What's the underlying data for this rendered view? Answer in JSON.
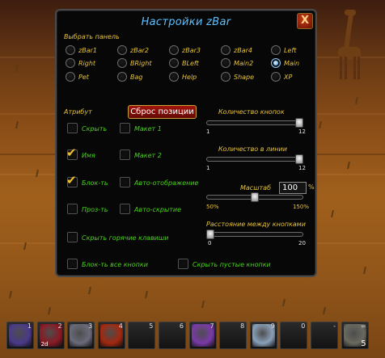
{
  "window": {
    "title": "Настройки zBar",
    "close_label": "X"
  },
  "panel_select": {
    "label": "Выбрать панель",
    "selected": "Main",
    "options": [
      "zBar1",
      "zBar2",
      "zBar3",
      "zBar4",
      "Left",
      "Right",
      "BRight",
      "BLeft",
      "Main2",
      "Main",
      "Pet",
      "Bag",
      "Help",
      "Shape",
      "XP"
    ]
  },
  "attribute": {
    "label": "Атрибут",
    "reset_button": "Сброс позиции"
  },
  "checkboxes": {
    "hide": {
      "label": "Скрыть",
      "checked": false
    },
    "layout1": {
      "label": "Макет 1",
      "checked": false
    },
    "name": {
      "label": "Имя",
      "checked": true
    },
    "layout2": {
      "label": "Макет 2",
      "checked": false
    },
    "lock": {
      "label": "Блок-ть",
      "checked": true
    },
    "auto_show": {
      "label": "Авто-отображение",
      "checked": false
    },
    "transparency": {
      "label": "Проз-ть",
      "checked": false
    },
    "auto_hide": {
      "label": "Авто-скрытие",
      "checked": false
    },
    "hide_hotkeys": {
      "label": "Скрыть горячие клавиши",
      "checked": false
    },
    "lock_all": {
      "label": "Блок-ть все кнопки",
      "checked": false
    },
    "hide_empty": {
      "label": "Скрыть пустые кнопки",
      "checked": false
    }
  },
  "sliders": {
    "button_count": {
      "label": "Количество кнопок",
      "min": "1",
      "max": "12",
      "value": 12
    },
    "per_line": {
      "label": "Количество в линии",
      "min": "1",
      "max": "12",
      "value": 12
    },
    "scale": {
      "label": "Масштаб",
      "value_text": "100",
      "unit": "%",
      "min": "50%",
      "max": "150%",
      "value": 100
    },
    "spacing": {
      "label": "Расстояние между кнопками",
      "min": "0",
      "max": "20",
      "value": 0
    }
  },
  "action_bar": {
    "slots": [
      {
        "hotkey": "1",
        "icon": "shadow-rogue-icon",
        "color": "#4b3a8a",
        "sub": "",
        "count": ""
      },
      {
        "hotkey": "2",
        "icon": "swirl-red-icon",
        "color": "#8a1a24",
        "sub": "2d",
        "count": ""
      },
      {
        "hotkey": "3",
        "icon": "wolf-head-icon",
        "color": "#6a6a7a",
        "sub": "",
        "count": ""
      },
      {
        "hotkey": "4",
        "icon": "red-beast-icon",
        "color": "#a32810",
        "sub": "",
        "count": ""
      },
      {
        "hotkey": "5",
        "icon": "",
        "color": "",
        "sub": "",
        "count": ""
      },
      {
        "hotkey": "6",
        "icon": "",
        "color": "",
        "sub": "",
        "count": ""
      },
      {
        "hotkey": "7",
        "icon": "purple-hand-icon",
        "color": "#7a3aa8",
        "sub": "",
        "count": ""
      },
      {
        "hotkey": "8",
        "icon": "",
        "color": "",
        "sub": "",
        "count": ""
      },
      {
        "hotkey": "9",
        "icon": "silver-orb-icon",
        "color": "#8aa0b8",
        "sub": "",
        "count": ""
      },
      {
        "hotkey": "0",
        "icon": "",
        "color": "",
        "sub": "",
        "count": ""
      },
      {
        "hotkey": "-",
        "icon": "",
        "color": "",
        "sub": "",
        "count": ""
      },
      {
        "hotkey": "=",
        "icon": "stone-bag-icon",
        "color": "#6a6a60",
        "sub": "",
        "count": "5"
      }
    ]
  }
}
